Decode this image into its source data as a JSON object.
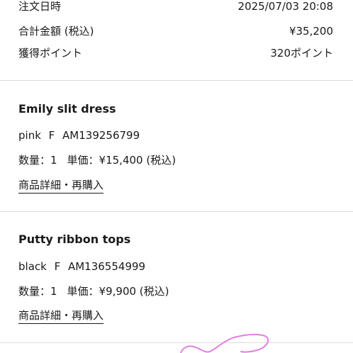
{
  "summary": {
    "order_date_label": "注文日時",
    "order_date_value": "2025/07/03 20:08",
    "total_label": "合計金額 (税込)",
    "total_value": "¥35,200",
    "points_label": "獲得ポイント",
    "points_value": "320ポイント"
  },
  "items": [
    {
      "name": "Emily slit dress",
      "variant": "pink   F   AM139256799",
      "quantity": "数量：1",
      "unit_price": "単価：¥15,400 (税込)",
      "link_label": "商品詳細・再購入"
    },
    {
      "name": "Putty ribbon tops",
      "variant": "black   F   AM136554999",
      "quantity": "数量：1",
      "unit_price": "単価：¥9,900 (税込)",
      "link_label": "商品詳細・再購入"
    }
  ],
  "colors": {
    "text": "#1a1a1a",
    "divider": "#dcdcdc",
    "annotation": "#e17fe0"
  }
}
